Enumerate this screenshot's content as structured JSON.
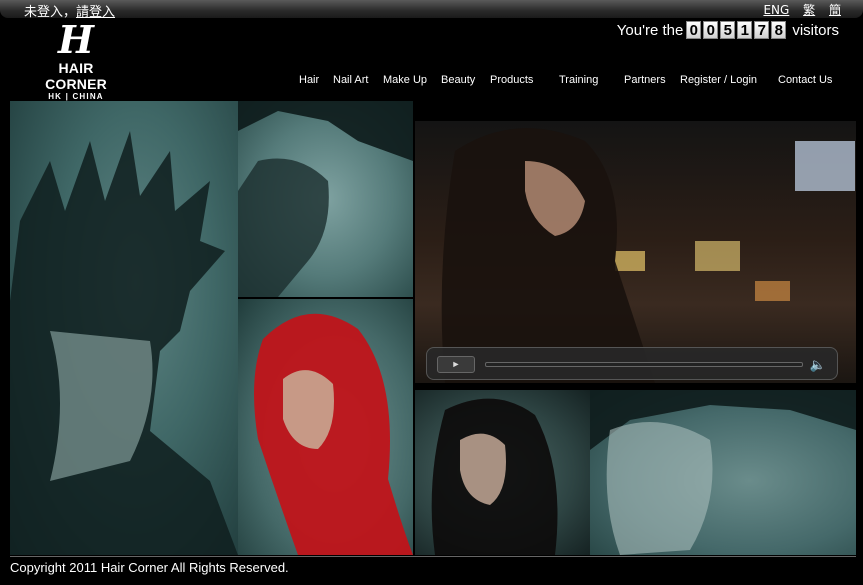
{
  "topbar": {
    "not_logged_in": "未登入，",
    "login_link": "請登入",
    "languages": [
      "ENG",
      "繁",
      "簡"
    ]
  },
  "logo": {
    "mark": "H",
    "name": "HAIR CORNER",
    "sub": "HK | CHINA"
  },
  "visitors": {
    "prefix": "You're the",
    "digits": [
      "0",
      "0",
      "5",
      "1",
      "7",
      "8"
    ],
    "suffix": "visitors"
  },
  "nav": [
    "Hair",
    "Nail Art",
    "Make Up",
    "Beauty",
    "Products",
    "Training",
    "Partners",
    "Register / Login",
    "Contact Us"
  ],
  "video": {
    "play_icon": "play-icon",
    "volume_icon": "volume-icon"
  },
  "footer": {
    "copyright": "Copyright 2011 Hair Corner All Rights Reserved."
  }
}
